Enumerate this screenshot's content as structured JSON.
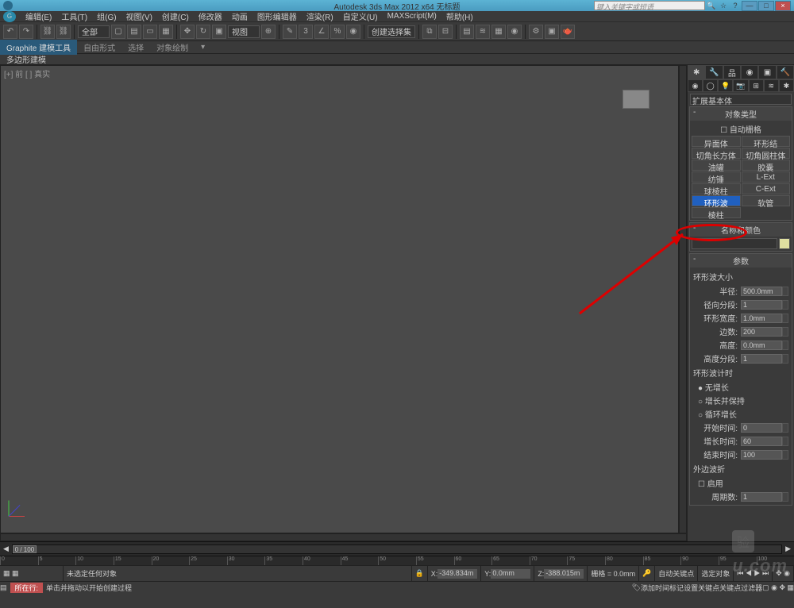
{
  "titlebar": {
    "app_title": "Autodesk 3ds Max 2012 x64   无标题",
    "search_placeholder": "键入关键字或短语",
    "min": "—",
    "max": "□",
    "close": "×"
  },
  "menu": {
    "items": [
      "编辑(E)",
      "工具(T)",
      "组(G)",
      "视图(V)",
      "创建(C)",
      "修改器",
      "动画",
      "图形编辑器",
      "渲染(R)",
      "自定义(U)",
      "MAXScript(M)",
      "帮助(H)"
    ]
  },
  "toolbar": {
    "selset_combo": "全部",
    "view_combo": "视图",
    "cmdset_combo": "创建选择集"
  },
  "ribbon": {
    "tab_main": "Graphite 建模工具",
    "tab_free": "自由形式",
    "tab_sel": "选择",
    "tab_obj": "对象绘制",
    "sub_poly": "多边形建模"
  },
  "viewport": {
    "label": "[+] 前 [ ] 真实"
  },
  "cmdpanel": {
    "category_combo": "扩展基本体",
    "rollout_objtype": "对象类型",
    "auto_gate": "自动栅格",
    "objbuttons": [
      [
        "异面体",
        "环形结"
      ],
      [
        "切角长方体",
        "切角圆柱体"
      ],
      [
        "油罐",
        "胶囊"
      ],
      [
        "纺锤",
        "L-Ext"
      ],
      [
        "球棱柱",
        "C-Ext"
      ],
      [
        "环形波",
        "软管"
      ],
      [
        "棱柱",
        ""
      ]
    ],
    "selected_obj": "环形波",
    "rollout_namecolor": "名称和颜色",
    "rollout_params": "参数",
    "section_size": "环形波大小",
    "p_radius": "半径:",
    "v_radius": "500.0mm",
    "p_radseg": "径向分段:",
    "v_radseg": "1",
    "p_ringwidth": "环形宽度:",
    "v_ringwidth": "1.0mm",
    "p_sides": "边数:",
    "v_sides": "200",
    "p_height": "高度:",
    "v_height": "0.0mm",
    "p_heightseg": "高度分段:",
    "v_heightseg": "1",
    "section_timing": "环形波计时",
    "radio_nogrowth": "无增长",
    "radio_growhold": "增长并保持",
    "radio_loop": "循环增长",
    "p_starttime": "开始时间:",
    "v_starttime": "0",
    "p_growtime": "增长时间:",
    "v_growtime": "60",
    "p_endtime": "结束时间:",
    "v_endtime": "100",
    "section_outer": "外边波折",
    "check_enable": "启用",
    "p_cycles": "周期数:",
    "v_cycles": "1"
  },
  "timeline": {
    "pos": "0 / 100",
    "ticks": [
      "0",
      "5",
      "10",
      "15",
      "20",
      "25",
      "30",
      "35",
      "40",
      "45",
      "50",
      "55",
      "60",
      "65",
      "70",
      "75",
      "80",
      "85",
      "90",
      "95",
      "100"
    ]
  },
  "status": {
    "no_sel": "未选定任何对象",
    "x_label": "X:",
    "x_val": "-349.834m",
    "y_label": "Y:",
    "y_val": "0.0mm",
    "z_label": "Z:",
    "z_val": "-388.015m",
    "grid": "栅格 = 0.0mm",
    "autokey": "自动关键点",
    "selobj": "选定对象",
    "track_label": "所在行:",
    "hint": "单击并拖动以开始创建过程",
    "add_timemark": "添加时间标记",
    "setkey": "设置关键点",
    "keyfilter": "关键点过滤器"
  },
  "watermark": "u.com"
}
